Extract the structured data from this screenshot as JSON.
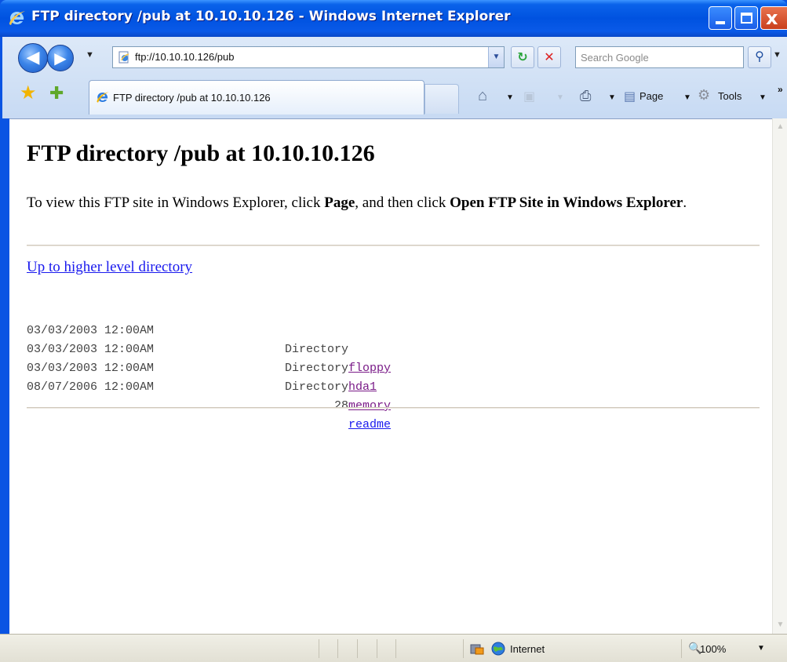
{
  "window": {
    "title": "FTP directory /pub at 10.10.10.126 - Windows Internet Explorer",
    "controls": {
      "close": "x"
    }
  },
  "toolbar": {
    "address": "ftp://10.10.10.126/pub",
    "search_placeholder": "Search Google",
    "tab_title": "FTP directory /pub at 10.10.10.126",
    "page_label": "Page",
    "tools_label": "Tools",
    "more": "»"
  },
  "page": {
    "heading": "FTP directory /pub at 10.10.10.126",
    "intro_1": "To view this FTP site in Windows Explorer, click ",
    "intro_bold_1": "Page",
    "intro_2": ", and then click ",
    "intro_bold_2": "Open FTP Site in Windows Explorer",
    "intro_3": ".",
    "up_link": "Up to higher level directory",
    "entries": [
      {
        "date": "03/03/2003 12:00AM",
        "kind": "Directory",
        "name": "floppy",
        "visited": true
      },
      {
        "date": "03/03/2003 12:00AM",
        "kind": "Directory",
        "name": "hda1",
        "visited": true
      },
      {
        "date": "03/03/2003 12:00AM",
        "kind": "Directory",
        "name": "memory",
        "visited": true
      },
      {
        "date": "08/07/2006 12:00AM",
        "kind": "28",
        "name": "readme",
        "visited": false
      }
    ]
  },
  "statusbar": {
    "zone": "Internet",
    "zoom": "100%"
  },
  "colors": {
    "link": "#1a1aee",
    "visited_link": "#7a1b88",
    "title_bar": "#0052e0"
  },
  "icons": [
    "ie-logo-icon",
    "back-icon",
    "forward-icon",
    "refresh-icon",
    "stop-icon",
    "search-icon",
    "favorites-star-icon",
    "add-favorites-icon",
    "home-icon",
    "feeds-icon",
    "print-icon",
    "page-icon",
    "tools-gear-icon",
    "lock-icon",
    "globe-icon",
    "zoom-icon"
  ]
}
